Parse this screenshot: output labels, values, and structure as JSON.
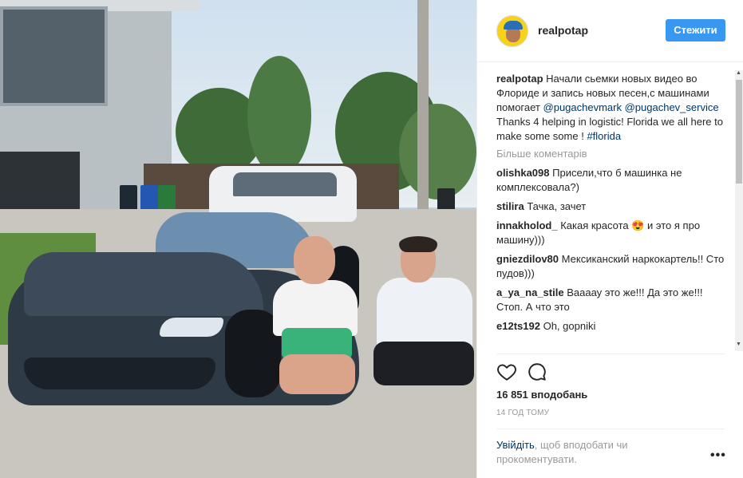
{
  "post": {
    "username": "realpotap",
    "follow_label": "Стежити",
    "caption": {
      "username": "realpotap",
      "text1": "Начали сьемки новых видео во Флориде и запись новых песен,с машинами помогает",
      "mention1": "@pugachevmark",
      "mention2": "@pugachev_service",
      "text2": "Thanks 4 helping in logistic! Florida we all here to make some some !",
      "hashtag": "#florida"
    },
    "more_comments": "Більше коментарів",
    "comments": [
      {
        "user": "olishka098",
        "text": "Присели,что б машинка не комплексовала?)"
      },
      {
        "user": "stilira",
        "text": "Тачка, зачет"
      },
      {
        "user": "innakholod_",
        "text": "Какая красота 😍 и это я про машину)))"
      },
      {
        "user": "gniezdilov80",
        "text": "Мексиканский наркокартель!! Сто пудов)))"
      },
      {
        "user": "a_ya_na_stile",
        "text": "Ваааау это же!!! Да это же!!! Стоп. А что это"
      },
      {
        "user": "e12ts192",
        "text": "Oh, gopniki"
      }
    ],
    "likes": "16 851 вподобань",
    "time": "14 ГОД ТОМУ",
    "login_link": "Увійдіть",
    "login_text": ", щоб вподобати чи прокоментувати.",
    "more_dots": "•••"
  },
  "icons": {
    "like": "heart-icon",
    "comment": "comment-bubble-icon",
    "options": "more-options-icon"
  },
  "colors": {
    "follow_button": "#3897f0",
    "link": "#003569",
    "muted": "#999999"
  }
}
